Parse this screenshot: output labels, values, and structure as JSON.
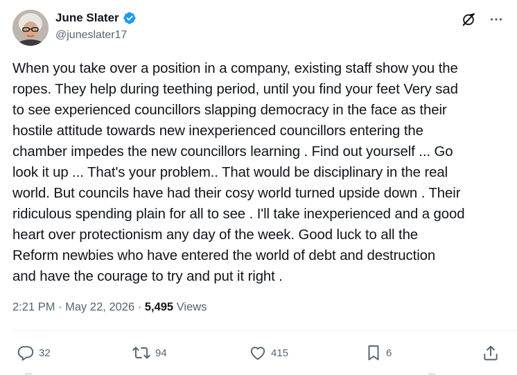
{
  "author": {
    "name": "June Slater",
    "handle": "@juneslater17",
    "verified": true,
    "verified_color": "#1d9bf0"
  },
  "top_icons": [
    "grok-slash-icon",
    "more-icon"
  ],
  "body_lines": [
    "When you take over a position in a company, existing staff show you the",
    "ropes. They help during teething period, until you find your feet  Very sad",
    "to see experienced councillors slapping democracy in the face as their",
    "hostile attitude towards new inexperienced councillors entering the",
    "chamber impedes the new councillors learning . Find out yourself ... Go",
    "look it up ... That's your problem.. That would be disciplinary in the real",
    "world. But councils have had their cosy world turned upside down . Their",
    "ridiculous spending plain for all to see . I'll take inexperienced and a good",
    "heart over protectionism any day of the week. Good luck to all the",
    "Reform newbies who have entered the world of debt and destruction",
    "and have the courage to try and put it right ."
  ],
  "meta": {
    "time": "2:21 PM",
    "separator": "·",
    "date": "May 22, 2026",
    "views_count": "5,495",
    "views_label": "Views"
  },
  "actions": {
    "replies": "32",
    "reposts": "94",
    "likes": "415",
    "bookmarks": "6"
  },
  "colors": {
    "text": "#0f1419",
    "secondary": "#536471",
    "divider": "#eff3f4"
  }
}
